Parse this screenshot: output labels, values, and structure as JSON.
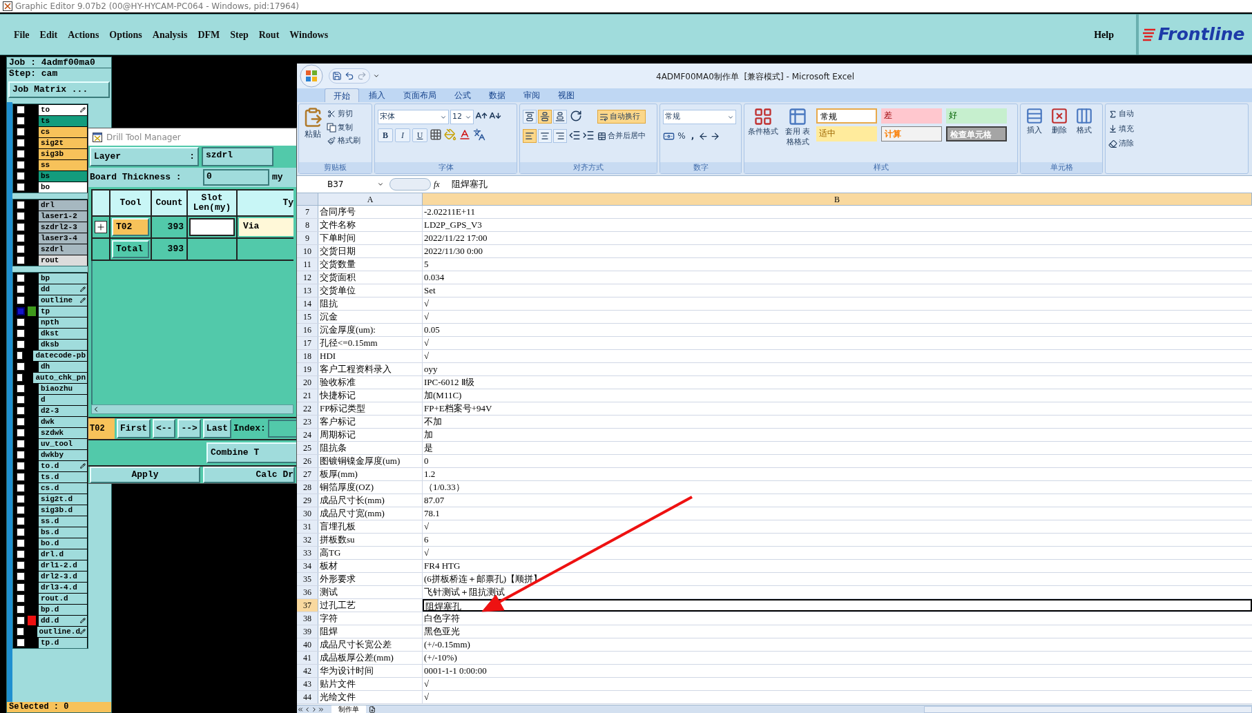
{
  "app_title": "Graphic Editor 9.07b2 (00@HY-HYCAM-PC064 - Windows, pid:17964)",
  "menu": [
    "File",
    "Edit",
    "Actions",
    "Options",
    "Analysis",
    "DFM",
    "Step",
    "Rout",
    "Windows"
  ],
  "help": "Help",
  "logo": "Frontline",
  "job_panel": {
    "job": "Job : 4admf00ma0",
    "step": "Step: cam",
    "job_matrix": "Job Matrix ...",
    "selected_count": "Selected : 0",
    "layer_groups": [
      {
        "layers": [
          {
            "name": "to",
            "color": "#ffffff",
            "selected": false,
            "marked": true
          },
          {
            "name": "ts",
            "color": "#139c7d",
            "selected": false,
            "marked": false
          },
          {
            "name": "cs",
            "color": "#f7c25a",
            "selected": false,
            "marked": false
          },
          {
            "name": "sig2t",
            "color": "#f7c25a",
            "selected": false,
            "marked": false
          },
          {
            "name": "sig3b",
            "color": "#f7c25a",
            "selected": false,
            "marked": false
          },
          {
            "name": "ss",
            "color": "#f7c25a",
            "selected": false,
            "marked": false
          },
          {
            "name": "bs",
            "color": "#139c7d",
            "selected": false,
            "marked": false
          },
          {
            "name": "bo",
            "color": "#ffffff",
            "selected": false,
            "marked": false
          }
        ]
      },
      {
        "layers": [
          {
            "name": "drl",
            "color": "#a6b8c0",
            "selected": false,
            "marked": false
          },
          {
            "name": "laser1-2",
            "color": "#a6b8c0",
            "selected": false,
            "marked": false
          },
          {
            "name": "szdrl2-3",
            "color": "#a6b8c0",
            "selected": false,
            "marked": false
          },
          {
            "name": "laser3-4",
            "color": "#a6b8c0",
            "selected": false,
            "marked": false
          },
          {
            "name": "szdrl",
            "color": "#a6b8c0",
            "selected": false,
            "marked": false
          },
          {
            "name": "rout",
            "color": "#dcdcdc",
            "selected": false,
            "marked": false
          }
        ]
      },
      {
        "layers": [
          {
            "name": "bp",
            "color": "#a0dcdc",
            "selected": false,
            "marked": false
          },
          {
            "name": "dd",
            "color": "#a0dcdc",
            "selected": false,
            "marked": true
          },
          {
            "name": "outline",
            "color": "#a0dcdc",
            "selected": false,
            "marked": true
          },
          {
            "name": "tp",
            "color": "#a0dcdc",
            "selected": true,
            "marked": false,
            "marker": {
              "color": "#3f9a1c"
            }
          },
          {
            "name": "npth",
            "color": "#a0dcdc",
            "selected": false,
            "marked": false
          },
          {
            "name": "dkst",
            "color": "#a0dcdc",
            "selected": false,
            "marked": false
          },
          {
            "name": "dksb",
            "color": "#a0dcdc",
            "selected": false,
            "marked": false
          },
          {
            "name": "datecode-pb",
            "color": "#a0dcdc",
            "selected": false,
            "marked": false
          },
          {
            "name": "dh",
            "color": "#a0dcdc",
            "selected": false,
            "marked": false
          },
          {
            "name": "auto_chk_pn",
            "color": "#a0dcdc",
            "selected": false,
            "marked": false
          },
          {
            "name": "biaozhu",
            "color": "#a0dcdc",
            "selected": false,
            "marked": false
          },
          {
            "name": "d",
            "color": "#a0dcdc",
            "selected": false,
            "marked": false
          },
          {
            "name": "d2-3",
            "color": "#a0dcdc",
            "selected": false,
            "marked": false
          },
          {
            "name": "dwk",
            "color": "#a0dcdc",
            "selected": false,
            "marked": false
          },
          {
            "name": "szdwk",
            "color": "#a0dcdc",
            "selected": false,
            "marked": false
          },
          {
            "name": "uv_tool",
            "color": "#a0dcdc",
            "selected": false,
            "marked": false
          },
          {
            "name": "dwkby",
            "color": "#a0dcdc",
            "selected": false,
            "marked": false
          },
          {
            "name": "to.d",
            "color": "#a0dcdc",
            "selected": false,
            "marked": true
          },
          {
            "name": "ts.d",
            "color": "#a0dcdc",
            "selected": false,
            "marked": false
          },
          {
            "name": "cs.d",
            "color": "#a0dcdc",
            "selected": false,
            "marked": false
          },
          {
            "name": "sig2t.d",
            "color": "#a0dcdc",
            "selected": false,
            "marked": false
          },
          {
            "name": "sig3b.d",
            "color": "#a0dcdc",
            "selected": false,
            "marked": false
          },
          {
            "name": "ss.d",
            "color": "#a0dcdc",
            "selected": false,
            "marked": false
          },
          {
            "name": "bs.d",
            "color": "#a0dcdc",
            "selected": false,
            "marked": false
          },
          {
            "name": "bo.d",
            "color": "#a0dcdc",
            "selected": false,
            "marked": false
          },
          {
            "name": "drl.d",
            "color": "#a0dcdc",
            "selected": false,
            "marked": false
          },
          {
            "name": "drl1-2.d",
            "color": "#a0dcdc",
            "selected": false,
            "marked": false
          },
          {
            "name": "drl2-3.d",
            "color": "#a0dcdc",
            "selected": false,
            "marked": false
          },
          {
            "name": "drl3-4.d",
            "color": "#a0dcdc",
            "selected": false,
            "marked": false
          },
          {
            "name": "rout.d",
            "color": "#a0dcdc",
            "selected": false,
            "marked": false
          },
          {
            "name": "bp.d",
            "color": "#a0dcdc",
            "selected": false,
            "marked": false
          },
          {
            "name": "dd.d",
            "color": "#a0dcdc",
            "selected": false,
            "marked": true,
            "marker": {
              "color": "#ee1111"
            }
          },
          {
            "name": "outline.d",
            "color": "#a0dcdc",
            "selected": false,
            "marked": true
          },
          {
            "name": "tp.d",
            "color": "#a0dcdc",
            "selected": false,
            "marked": false
          }
        ]
      }
    ]
  },
  "drill_tool_manager": {
    "title": "Drill Tool Manager",
    "layer_label": "Layer",
    "layer_colon": ":",
    "layer_value": "szdrl",
    "thickness_label": "Board Thickness :",
    "thickness_value": "0",
    "thickness_unit": "my",
    "columns": [
      "Tool",
      "Count",
      "Slot Len(my)",
      "Ty"
    ],
    "rows": [
      {
        "tool": "T02",
        "count": "393",
        "type": "Via"
      }
    ],
    "total": {
      "label": "Total",
      "count": "393"
    },
    "current_tool": "T02",
    "nav": [
      "First",
      "<--",
      "-->",
      "Last"
    ],
    "index_label": "Index:",
    "combine": "Combine T",
    "apply": "Apply",
    "calc": "Calc Dr"
  },
  "excel": {
    "title": "4ADMF00MA0制作单  [兼容模式] - Microsoft Excel",
    "tabs": [
      {
        "label": "开始",
        "selected": true
      },
      {
        "label": "插入",
        "selected": false
      },
      {
        "label": "页面布局",
        "selected": false
      },
      {
        "label": "公式",
        "selected": false
      },
      {
        "label": "数据",
        "selected": false
      },
      {
        "label": "审阅",
        "selected": false
      },
      {
        "label": "视图",
        "selected": false
      }
    ],
    "ribbon": {
      "clipboard": {
        "title": "剪贴板",
        "paste": "粘贴",
        "items": [
          "剪切",
          "复制",
          "格式刷"
        ]
      },
      "font": {
        "title": "字体",
        "family": "宋体",
        "size": "12",
        "bold": "B",
        "italic": "I",
        "underline": "U"
      },
      "alignment": {
        "title": "对齐方式",
        "wrap": "自动换行",
        "wrap_selected": true,
        "merge": "合并后居中",
        "vertical_align": [
          {
            "selected": false
          },
          {
            "selected": true
          },
          {
            "selected": false
          }
        ],
        "horizontal_align": [
          {
            "selected": true
          },
          {
            "selected": false
          },
          {
            "selected": false
          }
        ]
      },
      "number": {
        "title": "数字",
        "format": "常规",
        "percent": "%",
        "comma": ","
      },
      "styles": {
        "title": "样式",
        "conditional": "条件格式",
        "table_format": "套用 表格格式",
        "cells": [
          {
            "label": "常规",
            "kind": "normal"
          },
          {
            "label": "差",
            "kind": "bad"
          },
          {
            "label": "好",
            "kind": "good"
          },
          {
            "label": "适中",
            "kind": "neutral"
          },
          {
            "label": "计算",
            "kind": "calculation"
          },
          {
            "label": "检查单元格",
            "kind": "check"
          }
        ]
      },
      "cells": {
        "title": "单元格",
        "insert": "插入",
        "delete": "删除",
        "format": "格式"
      },
      "editing": {
        "sum": "自动",
        "fill": "填充",
        "clear": "清除"
      }
    },
    "name_box": "B37",
    "fx": "fx",
    "formula": "阻焊塞孔",
    "columns": [
      {
        "label": "A",
        "selected": false
      },
      {
        "label": "B",
        "selected": true
      }
    ],
    "rows": [
      {
        "n": "7",
        "a": "合同序号",
        "b": "-2.02211E+11",
        "selected": false
      },
      {
        "n": "8",
        "a": "文件名称",
        "b": "LD2P_GPS_V3",
        "selected": false
      },
      {
        "n": "9",
        "a": "下单时间",
        "b": "2022/11/22 17:00",
        "selected": false
      },
      {
        "n": "10",
        "a": "交货日期",
        "b": "2022/11/30 0:00",
        "selected": false
      },
      {
        "n": "11",
        "a": "交货数量",
        "b": "5",
        "selected": false
      },
      {
        "n": "12",
        "a": "交货面积",
        "b": "0.034",
        "selected": false
      },
      {
        "n": "13",
        "a": "交货单位",
        "b": "Set",
        "selected": false
      },
      {
        "n": "14",
        "a": "阻抗",
        "b": "√",
        "selected": false
      },
      {
        "n": "15",
        "a": "沉金",
        "b": "√",
        "selected": false
      },
      {
        "n": "16",
        "a": "沉金厚度(um):",
        "b": "0.05",
        "selected": false
      },
      {
        "n": "17",
        "a": "孔径<=0.15mm",
        "b": "√",
        "selected": false
      },
      {
        "n": "18",
        "a": "HDI",
        "b": "√",
        "selected": false
      },
      {
        "n": "19",
        "a": "客户工程资料录入",
        "b": "oyy",
        "selected": false
      },
      {
        "n": "20",
        "a": "验收标准",
        "b": "IPC-6012 Ⅱ级",
        "selected": false
      },
      {
        "n": "21",
        "a": "快捷标记",
        "b": "加(M11C)",
        "selected": false
      },
      {
        "n": "22",
        "a": "FP标记类型",
        "b": "FP+E档案号+94V",
        "selected": false
      },
      {
        "n": "23",
        "a": "客户标记",
        "b": "不加",
        "selected": false
      },
      {
        "n": "24",
        "a": "周期标记",
        "b": "加",
        "selected": false
      },
      {
        "n": "25",
        "a": "阻抗条",
        "b": "是",
        "selected": false
      },
      {
        "n": "26",
        "a": "图镀铜镍金厚度(um)",
        "b": "0",
        "selected": false
      },
      {
        "n": "27",
        "a": "板厚(mm)",
        "b": "1.2",
        "selected": false
      },
      {
        "n": "28",
        "a": "铜箔厚度(OZ)",
        "b": "（1/0.33）",
        "selected": false
      },
      {
        "n": "29",
        "a": "成品尺寸长(mm)",
        "b": "87.07",
        "selected": false
      },
      {
        "n": "30",
        "a": "成品尺寸宽(mm)",
        "b": "78.1",
        "selected": false
      },
      {
        "n": "31",
        "a": "盲埋孔板",
        "b": "√",
        "selected": false
      },
      {
        "n": "32",
        "a": "拼板数su",
        "b": "6",
        "selected": false
      },
      {
        "n": "33",
        "a": "高TG",
        "b": "√",
        "selected": false
      },
      {
        "n": "34",
        "a": "板材",
        "b": "FR4 HTG",
        "selected": false
      },
      {
        "n": "35",
        "a": "外形要求",
        "b": "(6拼板桥连＋邮票孔)【顺拼】",
        "selected": false
      },
      {
        "n": "36",
        "a": "测试",
        "b": "飞针测试＋阻抗测试",
        "selected": false
      },
      {
        "n": "37",
        "a": "过孔工艺",
        "b": "阻焊塞孔",
        "selected": true
      },
      {
        "n": "38",
        "a": "字符",
        "b": "白色字符",
        "selected": false
      },
      {
        "n": "39",
        "a": "阻焊",
        "b": "黑色亚光",
        "selected": false
      },
      {
        "n": "40",
        "a": "成品尺寸长宽公差",
        "b": "(+/-0.15mm)",
        "selected": false
      },
      {
        "n": "41",
        "a": "成品板厚公差(mm)",
        "b": "(+/-10%)",
        "selected": false
      },
      {
        "n": "42",
        "a": "华为设计时间",
        "b": "0001-1-1 0:00:00",
        "selected": false
      },
      {
        "n": "43",
        "a": "贴片文件",
        "b": "√",
        "selected": false
      },
      {
        "n": "44",
        "a": "光绘文件",
        "b": "√",
        "selected": false
      }
    ],
    "sheets": [
      {
        "label": "制作单",
        "selected": true
      }
    ]
  }
}
